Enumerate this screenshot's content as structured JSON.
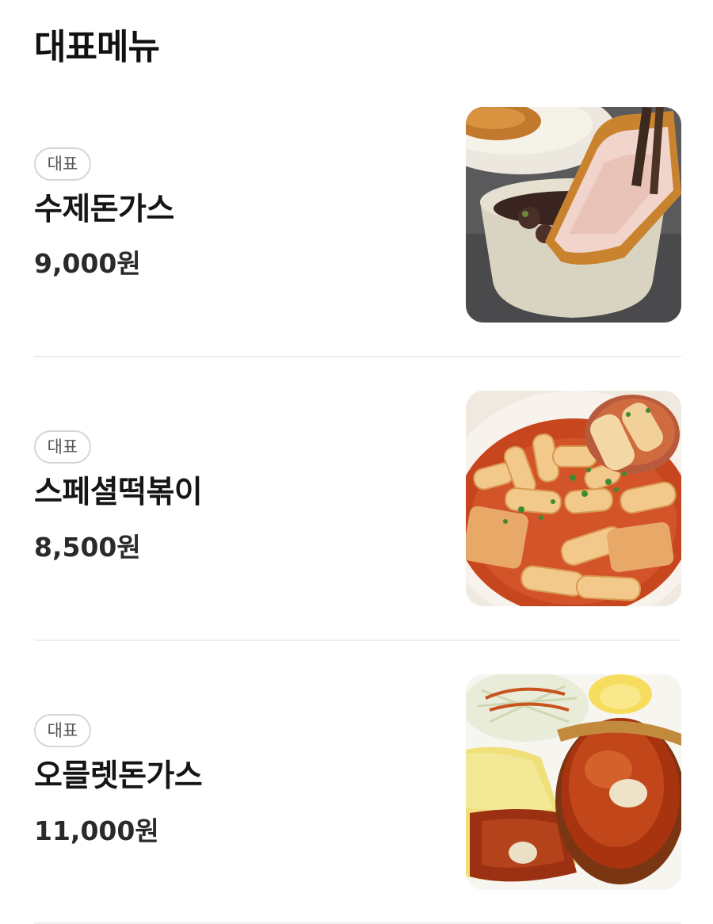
{
  "section": {
    "title": "대표메뉴"
  },
  "menu_items": [
    {
      "badge": "대표",
      "name": "수제돈가스",
      "price": "9,000원",
      "photo": "pork-cutlet-dipped-in-sauce-photo"
    },
    {
      "badge": "대표",
      "name": "스페셜떡볶이",
      "price": "8,500원",
      "photo": "spicy-rice-cake-photo"
    },
    {
      "badge": "대표",
      "name": "오믈렛돈가스",
      "price": "11,000원",
      "photo": "omelet-pork-cutlet-plate-photo"
    }
  ]
}
